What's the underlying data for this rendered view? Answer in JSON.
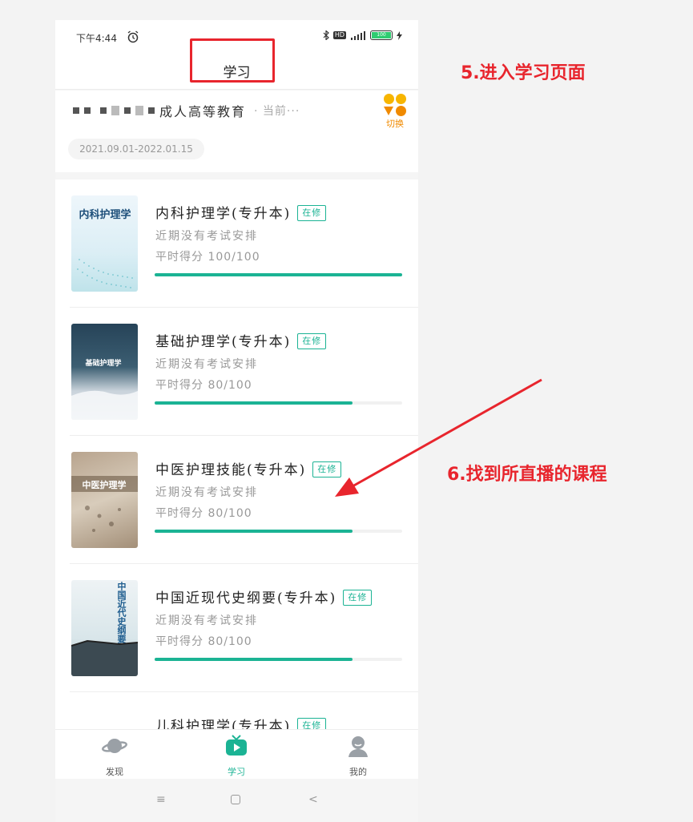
{
  "status_bar": {
    "time": "下午4:44",
    "hd": "HD",
    "battery": "100"
  },
  "header": {
    "title": "学习"
  },
  "school": {
    "name": "成人高等教育",
    "current": "· 当前···",
    "dates": "2021.09.01-2022.01.15",
    "switch_label": "切换"
  },
  "courses": [
    {
      "name": "内科护理学(专升本)",
      "tag": "在修",
      "exam": "近期没有考试安排",
      "score": "平时得分 100/100",
      "progress": 1.0,
      "cover_text": "内科护理学"
    },
    {
      "name": "基础护理学(专升本)",
      "tag": "在修",
      "exam": "近期没有考试安排",
      "score": "平时得分 80/100",
      "progress": 0.8,
      "cover_text": "基础护理学"
    },
    {
      "name": "中医护理技能(专升本)",
      "tag": "在修",
      "exam": "近期没有考试安排",
      "score": "平时得分 80/100",
      "progress": 0.8,
      "cover_text": "中医护理学"
    },
    {
      "name": "中国近现代史纲要(专升本)",
      "tag": "在修",
      "exam": "近期没有考试安排",
      "score": "平时得分 80/100",
      "progress": 0.8,
      "cover_text": "中国近代史纲要"
    },
    {
      "name": "儿科护理学(专升本)",
      "tag": "在修"
    }
  ],
  "tabs": [
    {
      "label": "发现",
      "icon": "planet-icon"
    },
    {
      "label": "学习",
      "icon": "tv-play-icon"
    },
    {
      "label": "我的",
      "icon": "user-icon"
    }
  ],
  "annotations": {
    "step5": "5.进入学习页面",
    "step6": "6.找到所直播的课程"
  },
  "colors": {
    "accent": "#1bb394",
    "annotation": "#e8252d",
    "switch": "#f08a00"
  }
}
